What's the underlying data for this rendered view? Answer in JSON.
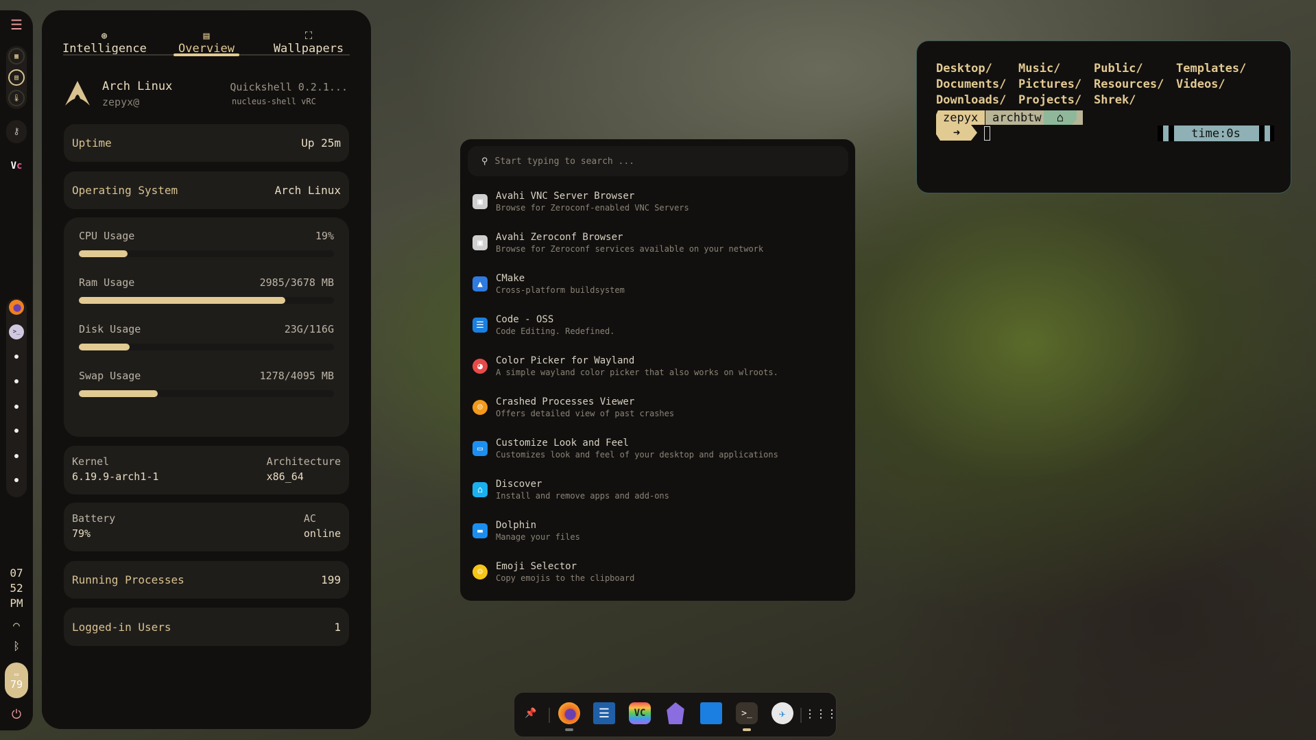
{
  "sidebar": {
    "clock": {
      "hour": "07",
      "minute": "52",
      "ampm": "PM"
    },
    "battery": "79"
  },
  "panel": {
    "tabs": [
      {
        "label": "Intelligence"
      },
      {
        "label": "Overview"
      },
      {
        "label": "Wallpapers"
      }
    ],
    "active_tab": "Overview",
    "os_name": "Arch Linux",
    "user": "zepyx@",
    "shell": "Quickshell 0.2.1...",
    "shell_version": "nucleus-shell vRC",
    "uptime": {
      "label": "Uptime",
      "value": "Up 25m"
    },
    "os": {
      "label": "Operating System",
      "value": "Arch Linux"
    },
    "usage": [
      {
        "label": "CPU Usage",
        "value": "19%",
        "fraction": 0.19
      },
      {
        "label": "Ram Usage",
        "value": "2985/3678 MB",
        "fraction": 0.81
      },
      {
        "label": "Disk Usage",
        "value": "23G/116G",
        "fraction": 0.2
      },
      {
        "label": "Swap Usage",
        "value": "1278/4095 MB",
        "fraction": 0.31
      }
    ],
    "kernel": {
      "label": "Kernel",
      "value": "6.19.9-arch1-1"
    },
    "arch": {
      "label": "Architecture",
      "value": "x86_64"
    },
    "battery": {
      "label": "Battery",
      "value": "79%"
    },
    "ac": {
      "label": "AC",
      "value": "online"
    },
    "processes": {
      "label": "Running Processes",
      "value": "199"
    },
    "users": {
      "label": "Logged-in Users",
      "value": "1"
    }
  },
  "launcher": {
    "placeholder": "Start typing to search ...",
    "apps": [
      {
        "name": "Avahi VNC Server Browser",
        "desc": "Browse for Zeroconf-enabled VNC Servers",
        "color": "#cfcfcf"
      },
      {
        "name": "Avahi Zeroconf Browser",
        "desc": "Browse for Zeroconf services available on your network",
        "color": "#cfcfcf"
      },
      {
        "name": "CMake",
        "desc": "Cross-platform buildsystem",
        "color": "#2f7be0"
      },
      {
        "name": "Code - OSS",
        "desc": "Code Editing. Redefined.",
        "color": "#1a7fe0"
      },
      {
        "name": "Color Picker for Wayland",
        "desc": "A simple wayland color picker that also works on wlroots.",
        "color": "#e84a4a"
      },
      {
        "name": "Crashed Processes Viewer",
        "desc": "Offers detailed view of past crashes",
        "color": "#f39a1a"
      },
      {
        "name": "Customize Look and Feel",
        "desc": "Customizes look and feel of your desktop and applications",
        "color": "#1d8ff0"
      },
      {
        "name": "Discover",
        "desc": "Install and remove apps and add-ons",
        "color": "#1ab0f0"
      },
      {
        "name": "Dolphin",
        "desc": "Manage your files",
        "color": "#1a8ef0"
      },
      {
        "name": "Emoji Selector",
        "desc": "Copy emojis to the clipboard",
        "color": "#f5c518"
      }
    ]
  },
  "terminal": {
    "dirs": [
      [
        "Desktop/",
        "Music/",
        "Public/",
        "Templates/"
      ],
      [
        "Documents/",
        "Pictures/",
        "Resources/",
        "Videos/"
      ],
      [
        "Downloads/",
        "Projects/",
        "Shrek/",
        ""
      ]
    ],
    "user": "zepyx",
    "host": "archbtw",
    "arrow": "➜",
    "time": "time:0s"
  },
  "colors": {
    "accent": "#e2ca93",
    "bg": "#12100e",
    "card": "#1f1d1a",
    "term_border": "#3e5a56"
  }
}
